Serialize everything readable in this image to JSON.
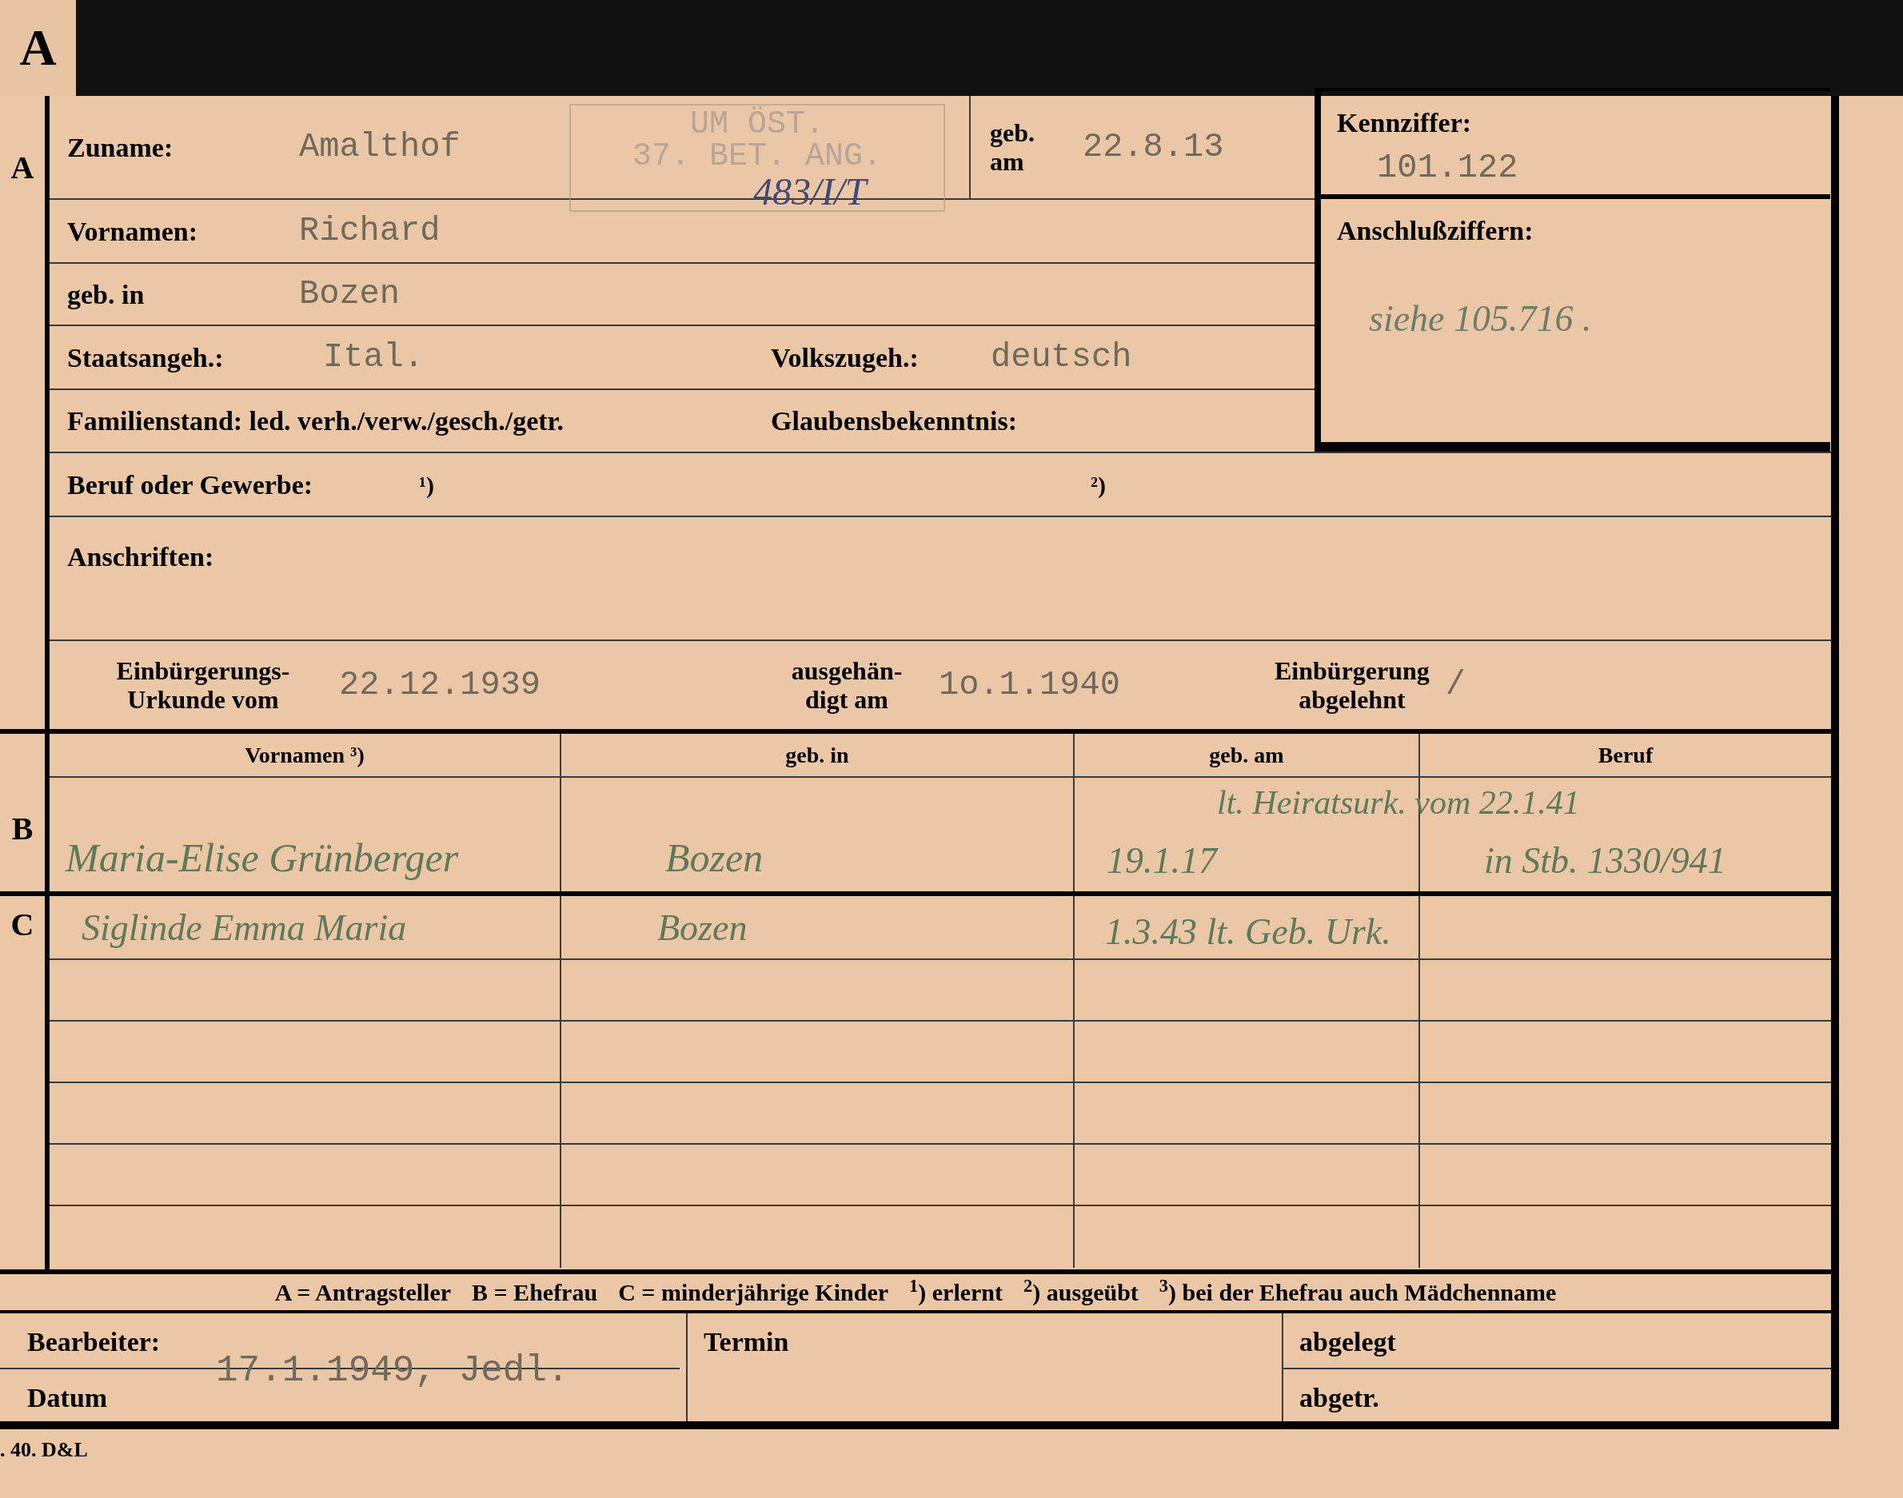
{
  "tab_letter": "A",
  "section_a": {
    "marker": "A",
    "surname": {
      "label": "Zuname:",
      "value": "Amalthof"
    },
    "stamp": {
      "lines": [
        "UM ÖST.",
        "37. BET. ANG."
      ],
      "note": "483/I/T"
    },
    "birth_date": {
      "label_lines": [
        "geb.",
        "am"
      ],
      "value": "22.8.13"
    },
    "given_names": {
      "label": "Vornamen:",
      "value": "Richard"
    },
    "birthplace": {
      "label": "geb. in",
      "value": "Bozen"
    },
    "citizenship": {
      "label": "Staatsangeh.:",
      "value": "Ital."
    },
    "ethnicity": {
      "label": "Volkszugeh.:",
      "value": "deutsch"
    },
    "marital_status": {
      "label": "Familienstand: led. verh./verw./gesch./getr."
    },
    "religion": {
      "label": "Glaubensbekenntnis:"
    },
    "occupation": {
      "label": "Beruf oder Gewerbe:",
      "note_1": "¹)",
      "note_2": "²)"
    },
    "addresses": {
      "label": "Anschriften:"
    },
    "naturalization": {
      "certificate_label": [
        "Einbürgerungs-",
        "Urkunde vom"
      ],
      "certificate_date": "22.12.1939",
      "handed_label": [
        "ausgehän-",
        "digt am"
      ],
      "handed_date": "1o.1.1940",
      "refused_label": [
        "Einbürgerung",
        "abgelehnt"
      ],
      "refused_mark": "/"
    }
  },
  "reference_box": {
    "kennziffer_label": "Kennziffer:",
    "kennziffer": "101.122",
    "anschluss_label": "Anschlußziffern:",
    "anschluss_note": "siehe 105.716 ."
  },
  "table": {
    "columns": [
      "Vornamen ³)",
      "geb. in",
      "geb. am",
      "Beruf"
    ],
    "spouse": {
      "marker": "B",
      "note": "lt. Heiratsurk. vom 22.1.41",
      "given_names": "Maria-Elise Grünberger",
      "birthplace": "Bozen",
      "birth_date": "19.1.17",
      "occupation": "in Stb. 1330/941"
    },
    "children": {
      "marker": "C",
      "rows": [
        {
          "given_names": "Siglinde Emma Maria",
          "birthplace": "Bozen",
          "birth_date": "1.3.43 lt. Geb. Urk."
        }
      ]
    }
  },
  "legend": [
    "A = Antragsteller",
    "B = Ehefrau",
    "C = minderjährige Kinder",
    "$^{1}$) erlernt",
    "$^{2}$) ausgeübt",
    "$^{3}$) bei der Ehefrau auch Mädchenname"
  ],
  "footer_fields": {
    "clerk_label": "Bearbeiter:",
    "clerk_entry": "17.1.1949, Jedl.",
    "date_label": "Datum",
    "deadline_label": "Termin",
    "filed_label": "abgelegt",
    "removed_label": "abgetr."
  },
  "print_code": ". 40. D&L"
}
